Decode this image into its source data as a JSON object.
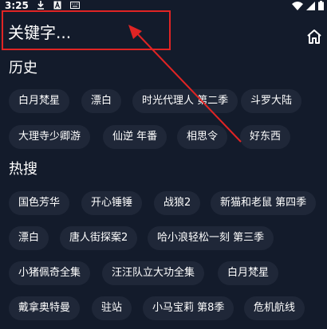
{
  "status_bar": {
    "time": "3:25"
  },
  "search": {
    "placeholder": "关键字..."
  },
  "history": {
    "title": "历史",
    "items": [
      "白月梵星",
      "漂白",
      "时光代理人 第二季",
      "斗罗大陆",
      "大理寺少卿游",
      "仙逆 年番",
      "相思令",
      "好东西"
    ]
  },
  "hot": {
    "title": "热搜",
    "items": [
      "国色芳华",
      "开心锤锤",
      "战狼2",
      "新猫和老鼠 第四季",
      "漂白",
      "唐人街探案2",
      "哈小浪轻松一刻 第三季",
      "小猪佩奇全集",
      "汪汪队立大功全集",
      "白月梵星",
      "戴拿奥特曼",
      "驻站",
      "小马宝莉 第8季",
      "危机航线"
    ]
  },
  "colors": {
    "background": "#131b2b",
    "chip": "#1f2738",
    "annotation": "#e02424"
  }
}
